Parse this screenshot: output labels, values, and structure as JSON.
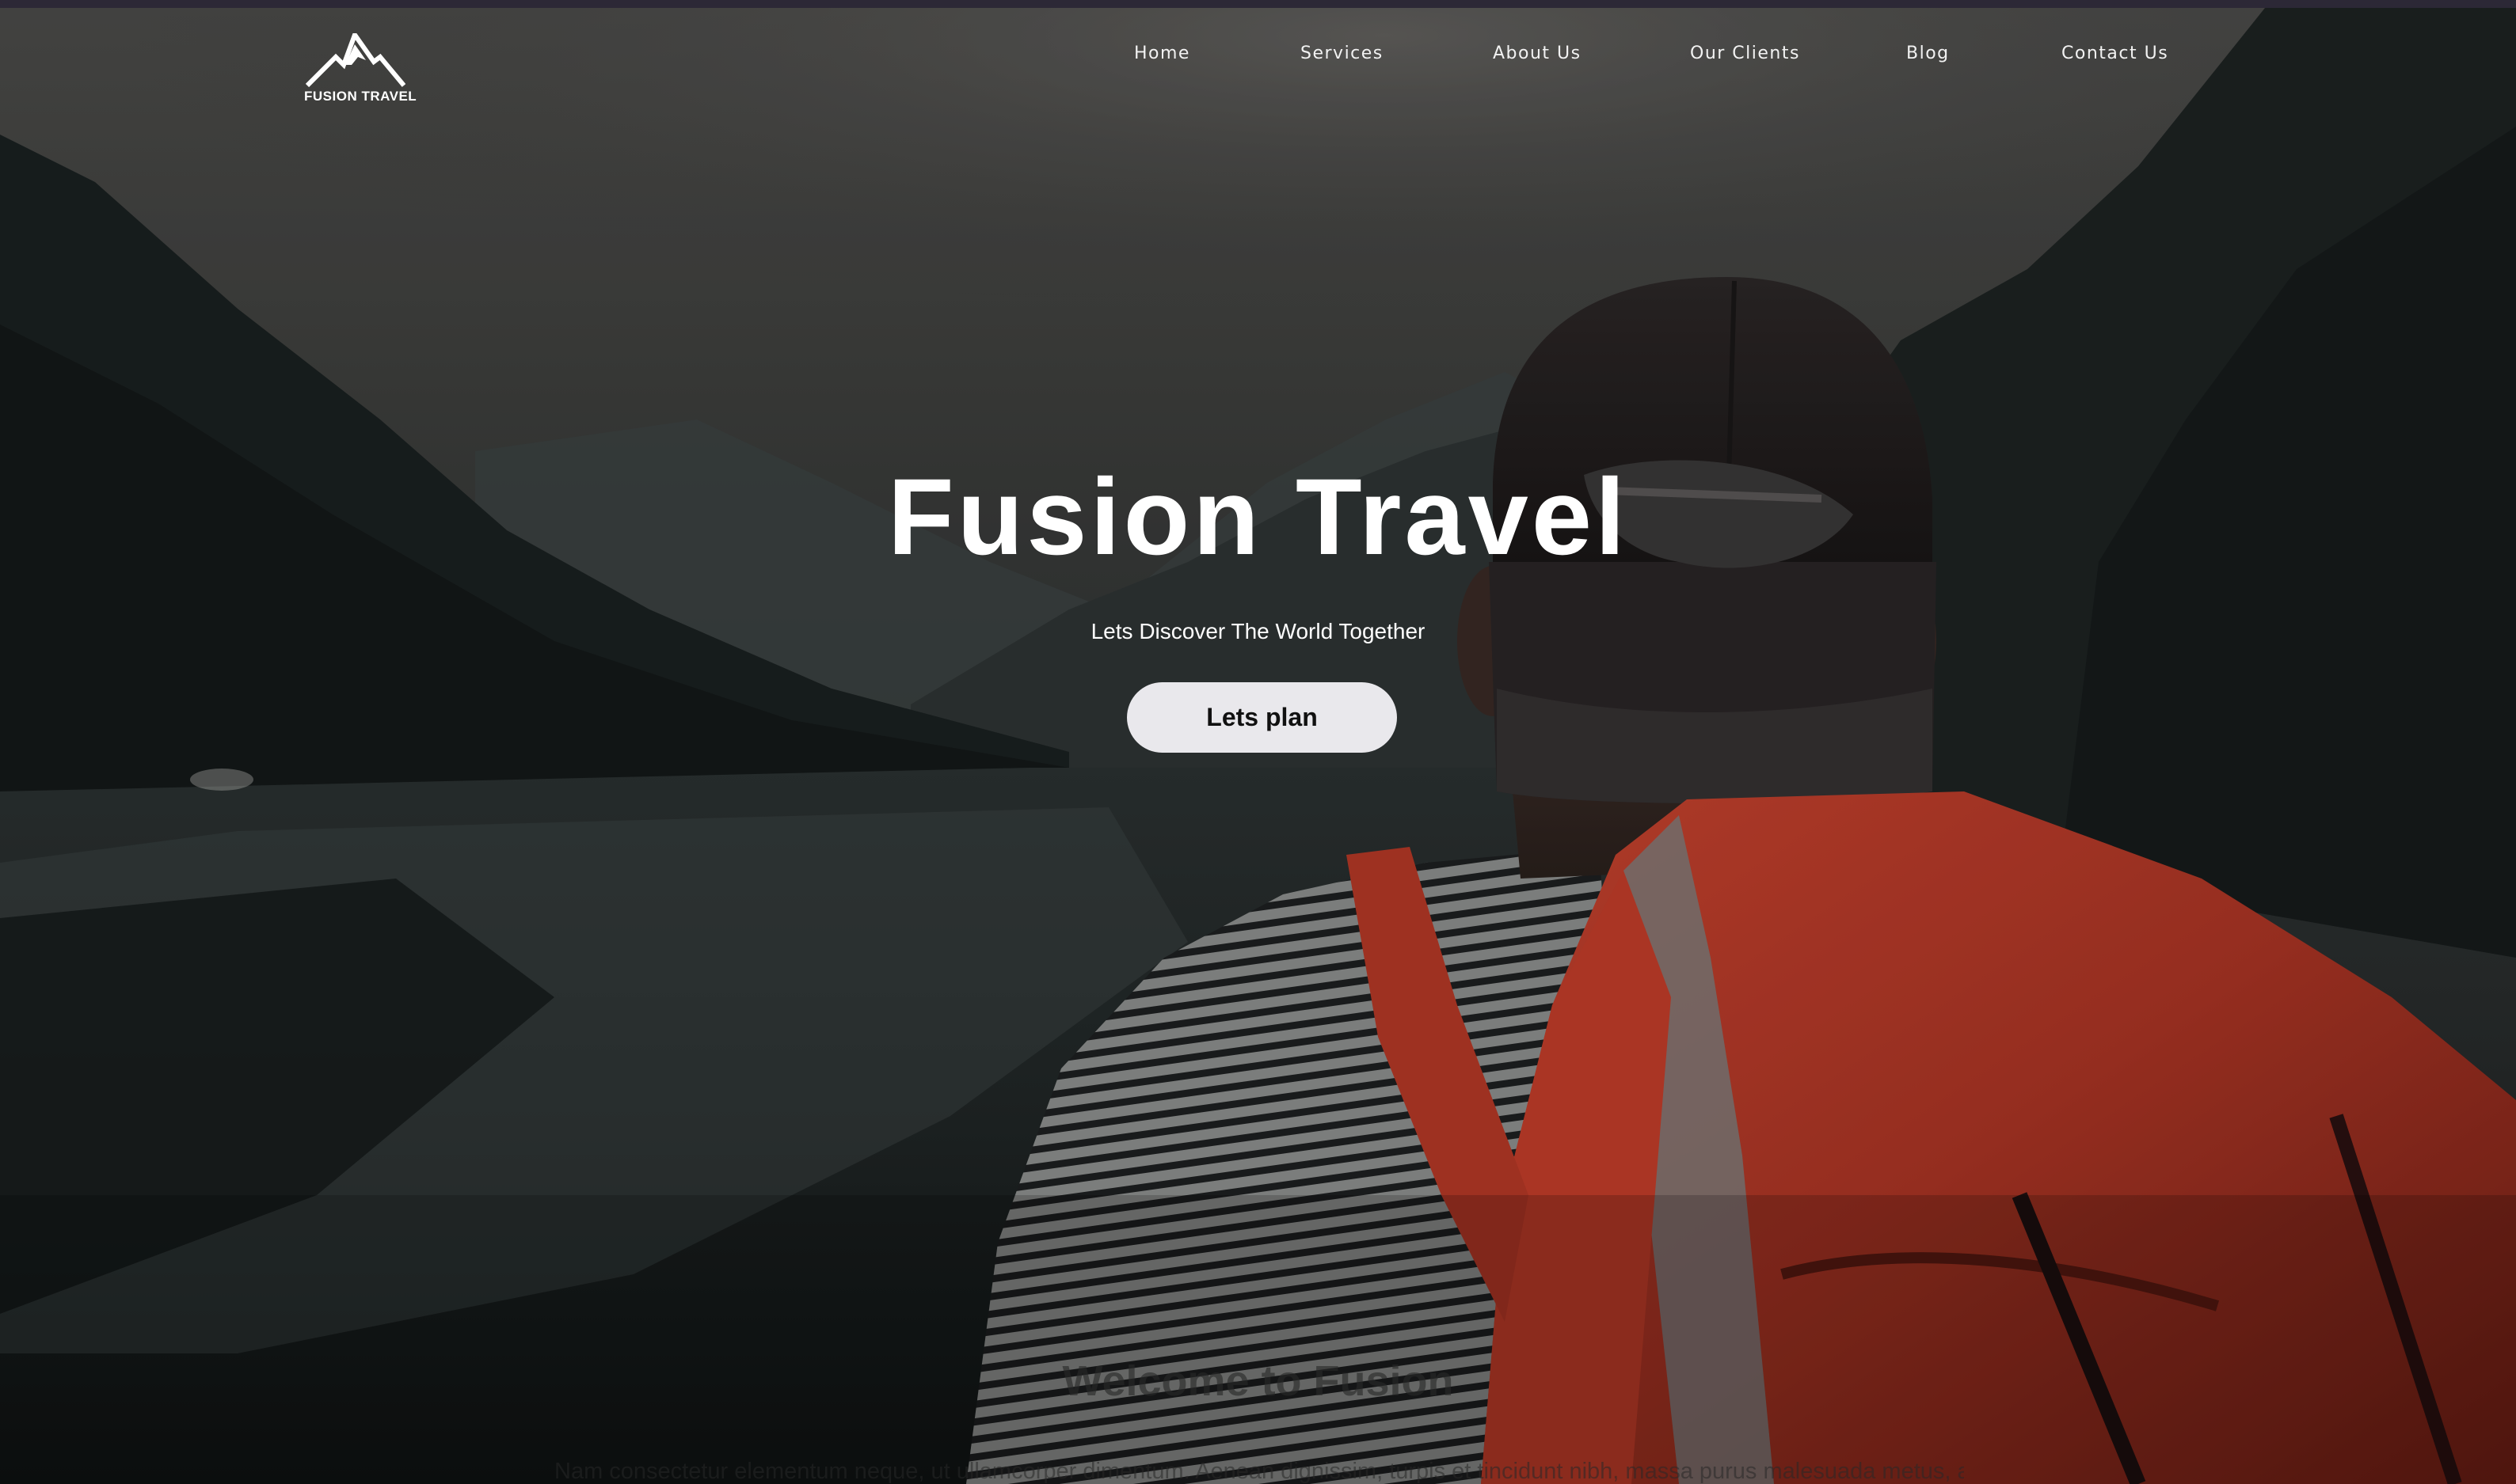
{
  "brand": {
    "logo_text": "FUSION TRAVEL"
  },
  "nav": {
    "items": [
      {
        "label": "Home"
      },
      {
        "label": "Services"
      },
      {
        "label": "About Us"
      },
      {
        "label": "Our Clients"
      },
      {
        "label": "Blog"
      },
      {
        "label": "Contact Us"
      }
    ]
  },
  "hero": {
    "title": "Fusion Travel",
    "subtitle": "Lets Discover The World Together",
    "cta_label": "Lets plan",
    "background_description_icon": "hiker-backpack-lake-mountains-photo"
  },
  "welcome": {
    "heading": "Welcome to Fusion",
    "text": "Nam consectetur elementum neque, ut ullamcorper dimentum. Aenean dignissim, turpis et tincidunt nibh, massa purus malesuada metus, a"
  },
  "colors": {
    "text": "#ffffff",
    "button_bg": "#e9e8ec",
    "button_text": "#111111",
    "backpack": "#b83a28",
    "background": "#15191a"
  }
}
